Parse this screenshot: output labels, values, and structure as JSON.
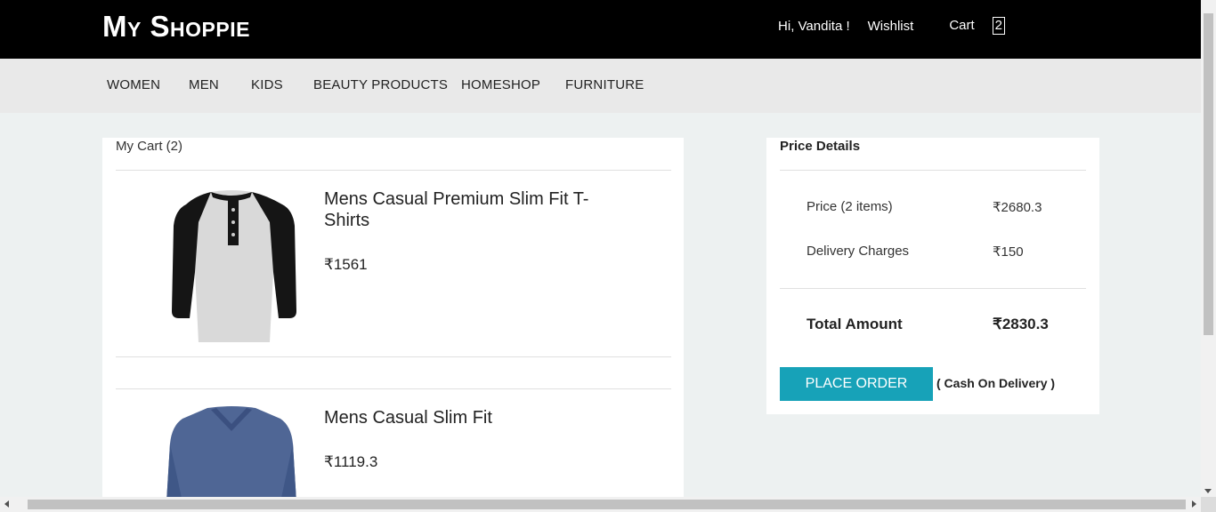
{
  "header": {
    "logo": "My Shoppie",
    "greeting": "Hi, Vandita !",
    "wishlist": "Wishlist",
    "cart_label": "Cart",
    "cart_count": "2"
  },
  "nav": {
    "items": [
      "WOMEN",
      "MEN",
      "KIDS",
      "BEAUTY PRODUCTS",
      "HOMESHOP",
      "FURNITURE"
    ]
  },
  "cart": {
    "title": "My Cart (2)",
    "items": [
      {
        "name": "Mens Casual Premium Slim Fit T-Shirts",
        "price": "₹1561",
        "image_icon": "raglan-henley-tshirt-image"
      },
      {
        "name": "Mens Casual Slim Fit",
        "price": "₹1119.3",
        "image_icon": "blue-vneck-tshirt-image"
      }
    ]
  },
  "price_details": {
    "title": "Price Details",
    "price_label": "Price (2 items)",
    "price_value": "₹2680.3",
    "delivery_label": "Delivery Charges",
    "delivery_value": "₹150",
    "total_label": "Total Amount",
    "total_value": "₹2830.3",
    "place_order": "PLACE ORDER",
    "payment_note": "( Cash On Delivery )"
  },
  "colors": {
    "header_bg": "#000000",
    "nav_bg": "#e9e9e9",
    "page_bg": "#edf1f1",
    "accent": "#17a2b8"
  }
}
